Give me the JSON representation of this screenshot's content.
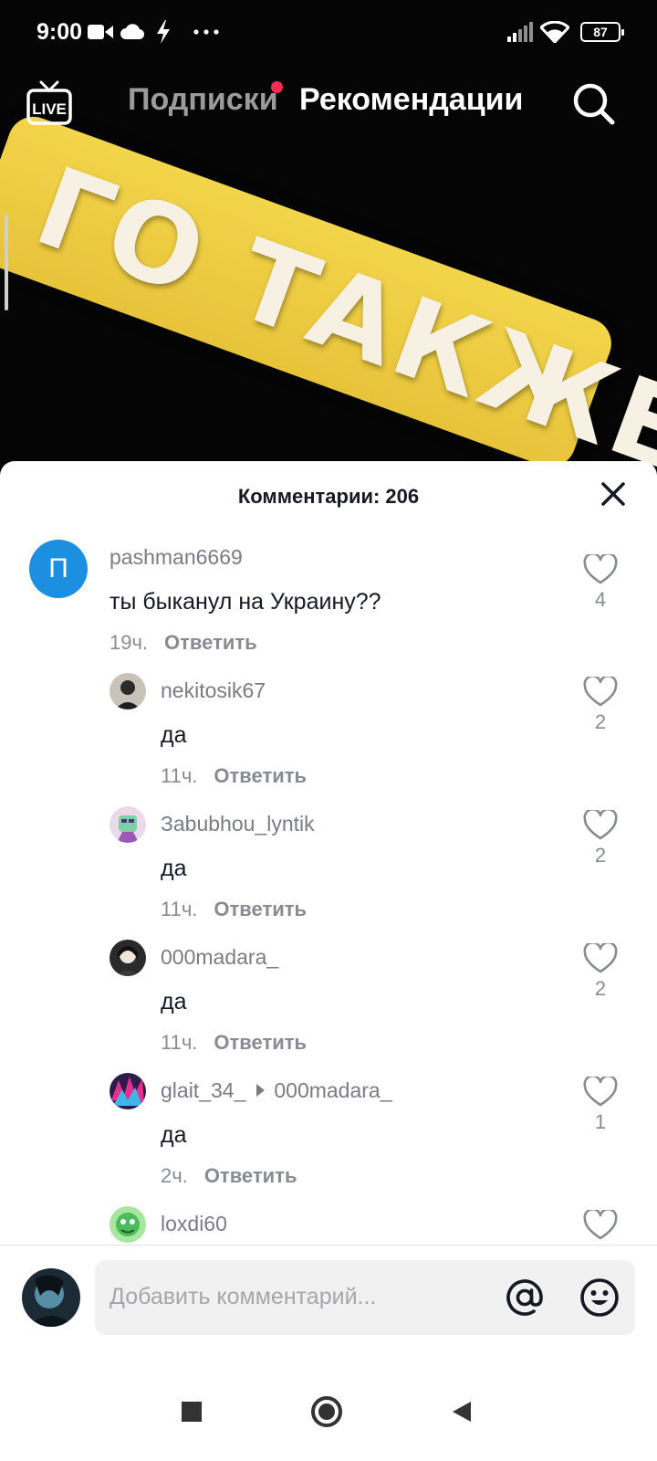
{
  "status_bar": {
    "time": "9:00",
    "battery": "87"
  },
  "video": {
    "sign_text": "ГО ТАКЖЕ ?"
  },
  "top_nav": {
    "live_label": "LIVE",
    "tab_following": "Подписки",
    "tab_foryou": "Рекомендации"
  },
  "sheet": {
    "title": "Комментарии: 206",
    "comments": [
      {
        "user": "pashman6669",
        "avatar_letter": "П",
        "text": "ты быканул на Украину??",
        "time": "19ч.",
        "reply": "Ответить",
        "likes": "4"
      },
      {
        "user": "nekitosik67",
        "text": "да",
        "time": "11ч.",
        "reply": "Ответить",
        "likes": "2"
      },
      {
        "user": "Зabubhou_lyntik",
        "text": "да",
        "time": "11ч.",
        "reply": "Ответить",
        "likes": "2"
      },
      {
        "user": "000madara_",
        "text": "да",
        "time": "11ч.",
        "reply": "Ответить",
        "likes": "2"
      },
      {
        "user": "glait_34_",
        "reply_to": "000madara_",
        "text": "да",
        "time": "2ч.",
        "reply": "Ответить",
        "likes": "1"
      },
      {
        "user": "loxdi60",
        "text": "",
        "time": "",
        "reply": "",
        "likes": ""
      }
    ]
  },
  "input": {
    "placeholder": "Добавить комментарий..."
  },
  "icons": {
    "live": "live-tv-icon",
    "search": "search-icon",
    "close": "close-icon",
    "heart": "heart-icon",
    "mention": "at-mention-icon",
    "emoji": "emoji-icon",
    "nav_recents": "square-icon",
    "nav_home": "circle-icon",
    "nav_back": "triangle-back-icon"
  },
  "colors": {
    "accent_red": "#fe2c55",
    "avatar_blue": "#1d8fe1",
    "sign_yellow": "#efcd45"
  }
}
